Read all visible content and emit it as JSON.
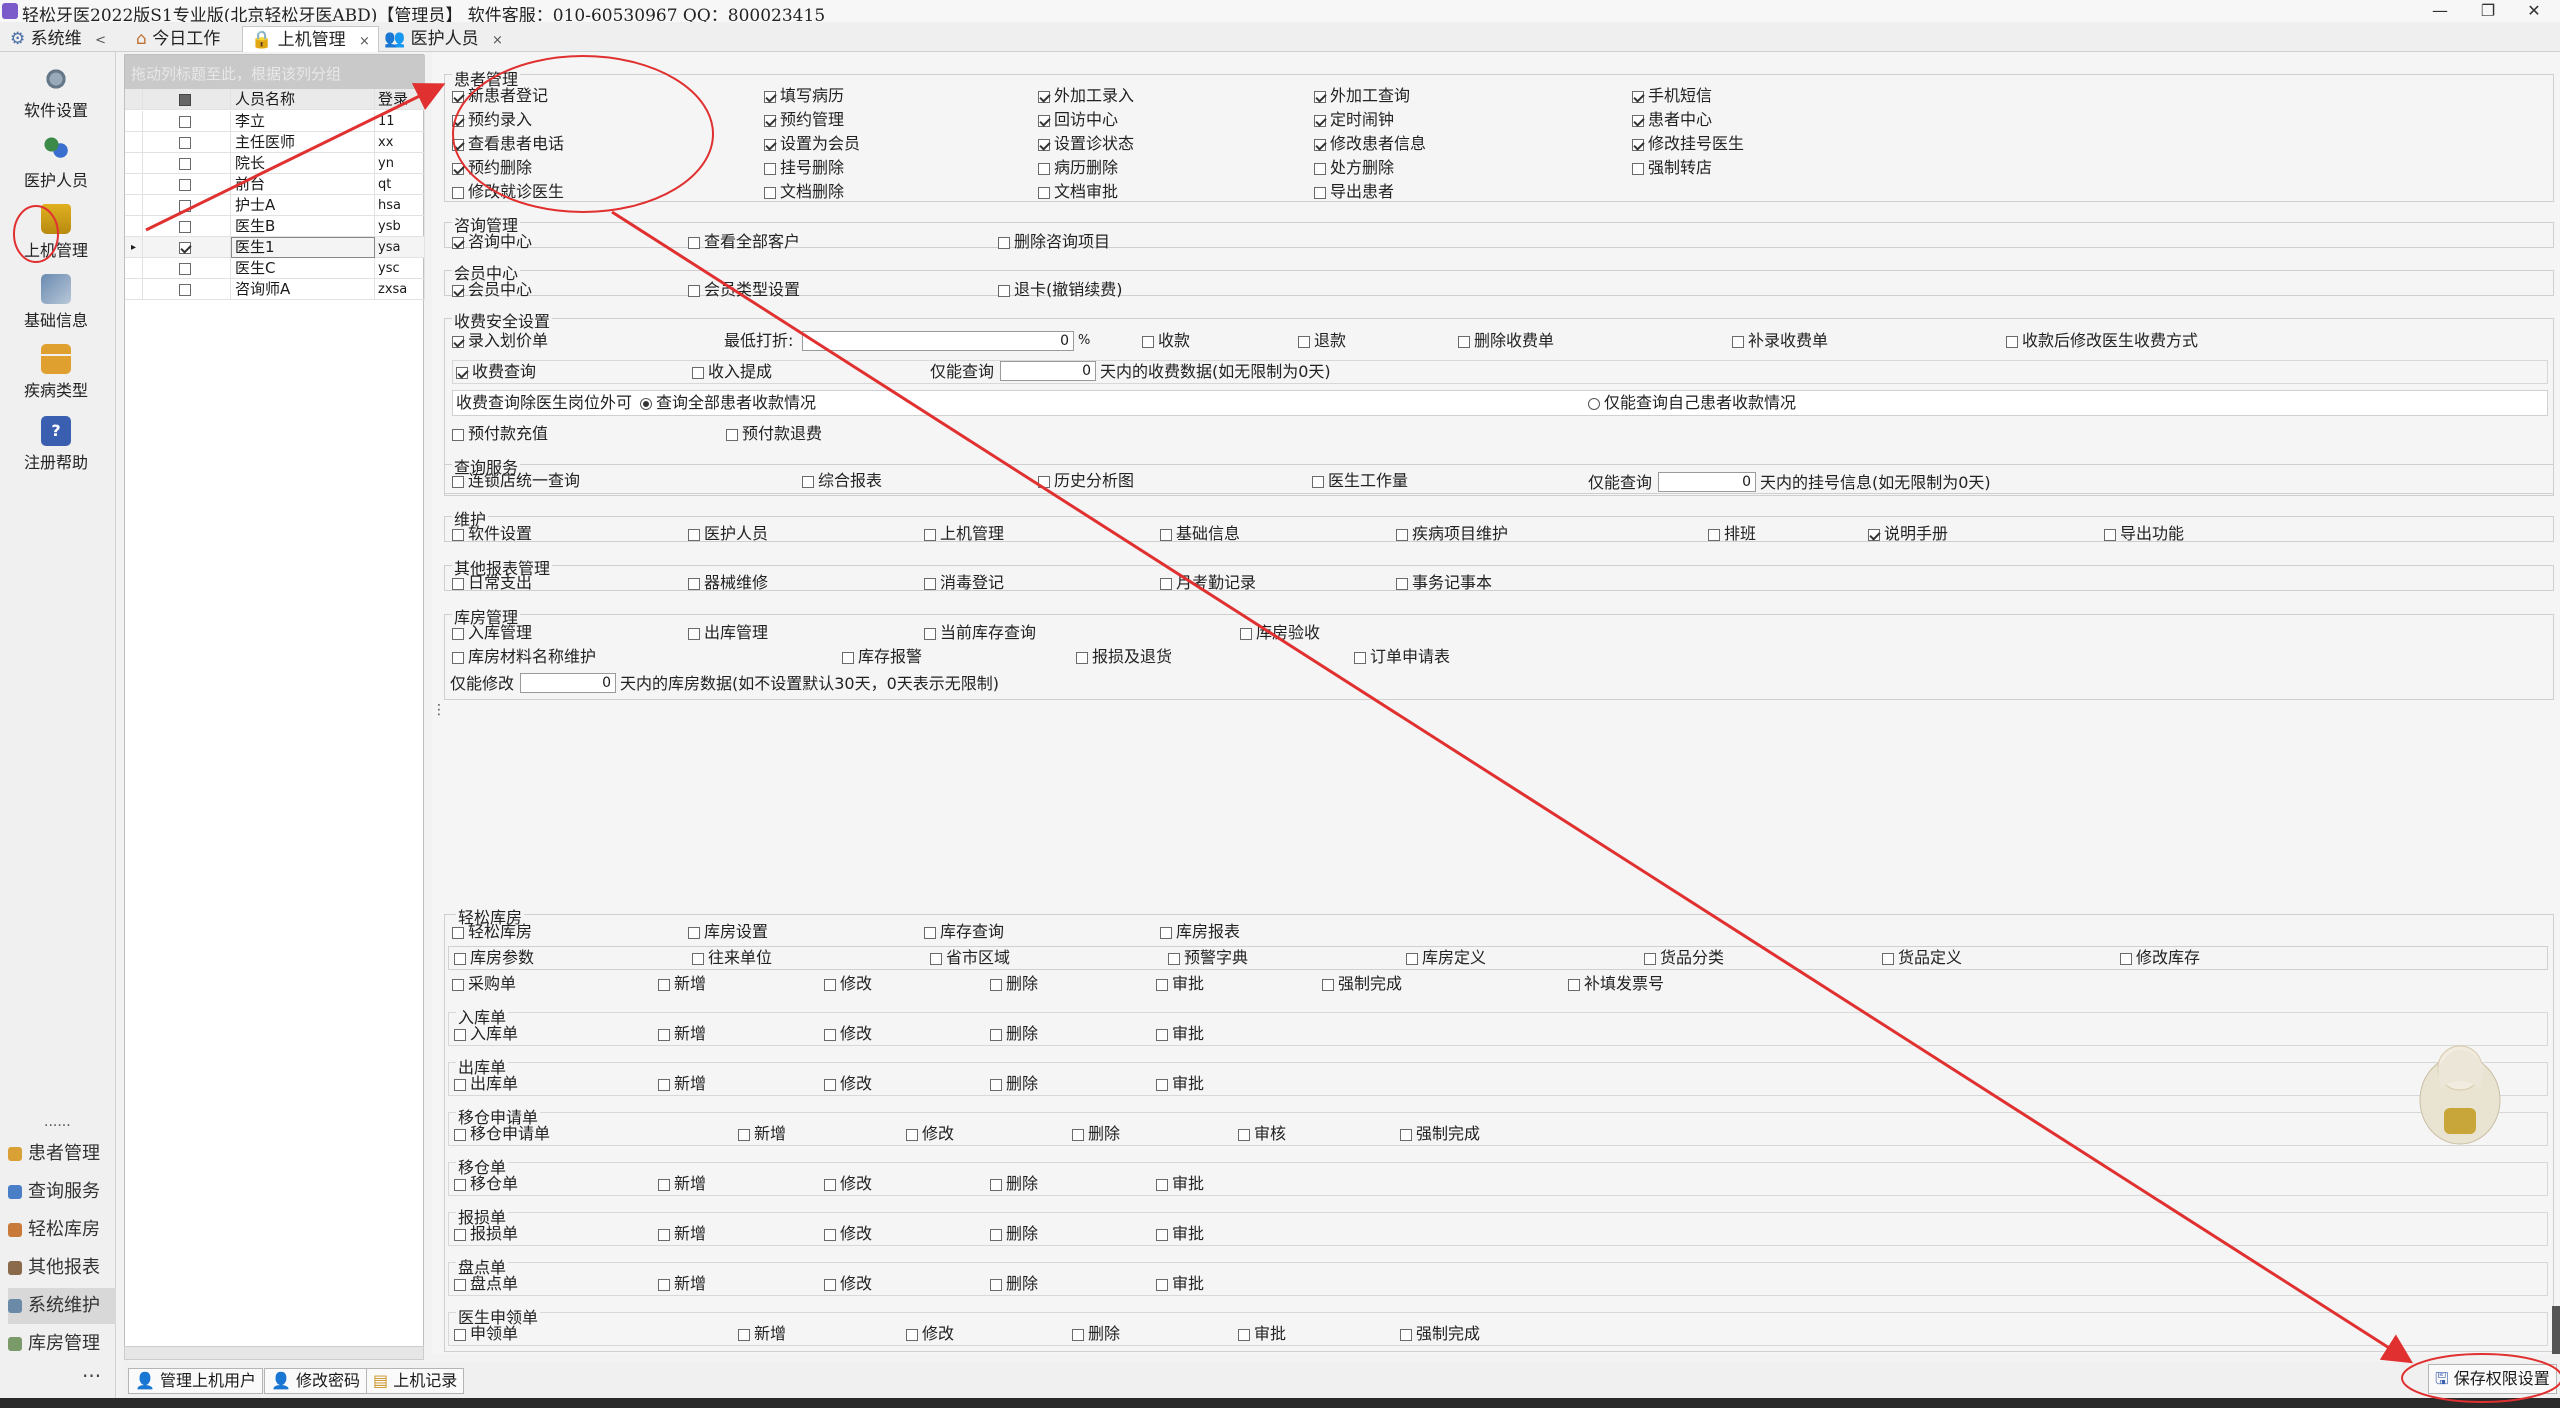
{
  "window": {
    "title": "轻松牙医2022版S1专业版(北京轻松牙医ABD)【管理员】    软件客服：010-60530967 QQ：800023415",
    "controls": [
      "—",
      "❐",
      "✕"
    ]
  },
  "tabs": [
    {
      "label": "系统维",
      "suffix": "<"
    },
    {
      "label": "今日工作"
    },
    {
      "label": "上机管理",
      "close": "×"
    },
    {
      "label": "医护人员",
      "close": "×"
    }
  ],
  "nav": {
    "big": [
      {
        "label": "软件设置",
        "icon": "gears-icon"
      },
      {
        "label": "医护人员",
        "icon": "people-icon"
      },
      {
        "label": "上机管理",
        "icon": "lock-icon"
      },
      {
        "label": "基础信息",
        "icon": "info-gears-icon"
      },
      {
        "label": "疾病类型",
        "icon": "tree-icon"
      },
      {
        "label": "注册帮助",
        "icon": "help-icon"
      }
    ],
    "dots": "......",
    "small": [
      {
        "label": "患者管理",
        "color": "#d9a036"
      },
      {
        "label": "查询服务",
        "color": "#4a7fc8"
      },
      {
        "label": "轻松库房",
        "color": "#c87a3a"
      },
      {
        "label": "其他报表",
        "color": "#8a6a4a"
      },
      {
        "label": "系统维护",
        "color": "#6a8aa8"
      },
      {
        "label": "库房管理",
        "color": "#7a9a6a"
      }
    ],
    "more": "···"
  },
  "grid": {
    "hint": "拖动列标题至此，根据该列分组",
    "headers": [
      "人员名称",
      "登录"
    ],
    "rows": [
      {
        "name": "李立",
        "code": "11",
        "checked": false
      },
      {
        "name": "主任医师",
        "code": "xx",
        "checked": false
      },
      {
        "name": "院长",
        "code": "yn",
        "checked": false
      },
      {
        "name": "前台",
        "code": "qt",
        "checked": false
      },
      {
        "name": "护士A",
        "code": "hsa",
        "checked": false
      },
      {
        "name": "医生B",
        "code": "ysb",
        "checked": false
      },
      {
        "name": "医生1",
        "code": "ysa",
        "checked": true,
        "selected": true
      },
      {
        "name": "医生C",
        "code": "ysc",
        "checked": false
      },
      {
        "name": "咨询师A",
        "code": "zxsa",
        "checked": false
      }
    ]
  },
  "sections": {
    "patient": {
      "title": "患者管理",
      "items": [
        {
          "label": "新患者登记",
          "checked": true
        },
        {
          "label": "填写病历",
          "checked": true
        },
        {
          "label": "外加工录入",
          "checked": true
        },
        {
          "label": "外加工查询",
          "checked": true
        },
        {
          "label": "手机短信",
          "checked": true
        },
        {
          "label": "预约录入",
          "checked": true
        },
        {
          "label": "预约管理",
          "checked": true
        },
        {
          "label": "回访中心",
          "checked": true
        },
        {
          "label": "定时闹钟",
          "checked": true
        },
        {
          "label": "患者中心",
          "checked": true
        },
        {
          "label": "查看患者电话",
          "checked": true
        },
        {
          "label": "设置为会员",
          "checked": true
        },
        {
          "label": "设置诊状态",
          "checked": true
        },
        {
          "label": "修改患者信息",
          "checked": true
        },
        {
          "label": "修改挂号医生",
          "checked": true
        },
        {
          "label": "预约删除",
          "checked": true
        },
        {
          "label": "挂号删除",
          "checked": false
        },
        {
          "label": "病历删除",
          "checked": false
        },
        {
          "label": "处方删除",
          "checked": false
        },
        {
          "label": "强制转店",
          "checked": false
        },
        {
          "label": "修改就诊医生",
          "checked": false
        },
        {
          "label": "文档删除",
          "checked": false
        },
        {
          "label": "文档审批",
          "checked": false
        },
        {
          "label": "导出患者",
          "checked": false
        }
      ]
    },
    "consult": {
      "title": "咨询管理",
      "items": [
        {
          "label": "咨询中心",
          "checked": true
        },
        {
          "label": "查看全部客户",
          "checked": false
        },
        {
          "label": "删除咨询项目",
          "checked": false
        }
      ]
    },
    "member": {
      "title": "会员中心",
      "items": [
        {
          "label": "会员中心",
          "checked": true
        },
        {
          "label": "会员类型设置",
          "checked": false
        },
        {
          "label": "退卡(撤销续费)",
          "checked": false
        }
      ]
    },
    "fee": {
      "title": "收费安全设置",
      "row1": [
        {
          "label": "录入划价单",
          "checked": true
        },
        {
          "label": "收款",
          "checked": false
        },
        {
          "label": "退款",
          "checked": false
        },
        {
          "label": "删除收费单",
          "checked": false
        },
        {
          "label": "补录收费单",
          "checked": false
        },
        {
          "label": "收款后修改医生收费方式",
          "checked": false
        }
      ],
      "discount_label": "最低打折:",
      "discount_value": "0",
      "discount_unit": "%",
      "row2": [
        {
          "label": "收费查询",
          "checked": true
        },
        {
          "label": "收入提成",
          "checked": false
        }
      ],
      "query_label": "仅能查询",
      "query_value": "0",
      "query_suffix": "天内的收费数据(如无限制为0天)",
      "radio_label": "收费查询除医生岗位外可",
      "radio_all": "查询全部患者收款情况",
      "radio_self": "仅能查询自己患者收款情况",
      "row3": [
        {
          "label": "预付款充值",
          "checked": false
        },
        {
          "label": "预付款退费",
          "checked": false
        }
      ]
    },
    "query": {
      "title": "查询服务",
      "items": [
        {
          "label": "连锁店统一查询",
          "checked": false
        },
        {
          "label": "综合报表",
          "checked": false
        },
        {
          "label": "历史分析图",
          "checked": false
        },
        {
          "label": "医生工作量",
          "checked": false
        }
      ],
      "limit_label": "仅能查询",
      "limit_value": "0",
      "limit_suffix": "天内的挂号信息(如无限制为0天)"
    },
    "maint": {
      "title": "维护",
      "items": [
        {
          "label": "软件设置",
          "checked": false
        },
        {
          "label": "医护人员",
          "checked": false
        },
        {
          "label": "上机管理",
          "checked": false
        },
        {
          "label": "基础信息",
          "checked": false
        },
        {
          "label": "疾病项目维护",
          "checked": false
        },
        {
          "label": "排班",
          "checked": false
        },
        {
          "label": "说明手册",
          "checked": true
        },
        {
          "label": "导出功能",
          "checked": false
        }
      ]
    },
    "other": {
      "title": "其他报表管理",
      "items": [
        {
          "label": "日常支出",
          "checked": false
        },
        {
          "label": "器械维修",
          "checked": false
        },
        {
          "label": "消毒登记",
          "checked": false
        },
        {
          "label": "月考勤记录",
          "checked": false
        },
        {
          "label": "事务记事本",
          "checked": false
        }
      ]
    },
    "store": {
      "title": "库房管理",
      "row1": [
        {
          "label": "入库管理",
          "checked": false
        },
        {
          "label": "出库管理",
          "checked": false
        },
        {
          "label": "当前库存查询",
          "checked": false
        },
        {
          "label": "库房验收",
          "checked": false
        }
      ],
      "row2": [
        {
          "label": "库房材料名称维护",
          "checked": false
        },
        {
          "label": "库存报警",
          "checked": false
        },
        {
          "label": "报损及退货",
          "checked": false
        },
        {
          "label": "订单申请表",
          "checked": false
        }
      ],
      "limit_label": "仅能修改",
      "limit_value": "0",
      "limit_suffix": "天内的库房数据(如不设置默认30天，0天表示无限制)"
    },
    "easystore": {
      "title": "轻松库房",
      "row1": [
        {
          "label": "轻松库房",
          "checked": false
        },
        {
          "label": "库房设置",
          "checked": false
        },
        {
          "label": "库存查询",
          "checked": false
        },
        {
          "label": "库房报表",
          "checked": false
        }
      ],
      "row2": [
        {
          "label": "库房参数",
          "checked": false
        },
        {
          "label": "往来单位",
          "checked": false
        },
        {
          "label": "省市区域",
          "checked": false
        },
        {
          "label": "预警字典",
          "checked": false
        },
        {
          "label": "库房定义",
          "checked": false
        },
        {
          "label": "货品分类",
          "checked": false
        },
        {
          "label": "货品定义",
          "checked": false
        },
        {
          "label": "修改库存",
          "checked": false
        }
      ],
      "row3": [
        {
          "label": "采购单",
          "checked": false
        },
        {
          "label": "新增",
          "checked": false
        },
        {
          "label": "修改",
          "checked": false
        },
        {
          "label": "删除",
          "checked": false
        },
        {
          "label": "审批",
          "checked": false
        },
        {
          "label": "强制完成",
          "checked": false
        },
        {
          "label": "补填发票号",
          "checked": false
        }
      ],
      "groups": [
        {
          "title": "入库单",
          "items": [
            "入库单",
            "新增",
            "修改",
            "删除",
            "审批"
          ]
        },
        {
          "title": "出库单",
          "items": [
            "出库单",
            "新增",
            "修改",
            "删除",
            "审批"
          ]
        },
        {
          "title": "移仓申请单",
          "items": [
            "移仓申请单",
            "新增",
            "修改",
            "删除",
            "审核",
            "强制完成"
          ]
        },
        {
          "title": "移仓单",
          "items": [
            "移仓单",
            "新增",
            "修改",
            "删除",
            "审批"
          ]
        },
        {
          "title": "报损单",
          "items": [
            "报损单",
            "新增",
            "修改",
            "删除",
            "审批"
          ]
        },
        {
          "title": "盘点单",
          "items": [
            "盘点单",
            "新增",
            "修改",
            "删除",
            "审批"
          ]
        },
        {
          "title": "医生申领单",
          "items": [
            "申领单",
            "新增",
            "修改",
            "删除",
            "审批",
            "强制完成"
          ]
        }
      ]
    }
  },
  "bottom": {
    "buttons": [
      "管理上机用户",
      "修改密码",
      "上机记录"
    ],
    "save": "保存权限设置"
  },
  "colors": {
    "annotation": "#e03030",
    "accent": "#3a6fd0"
  }
}
